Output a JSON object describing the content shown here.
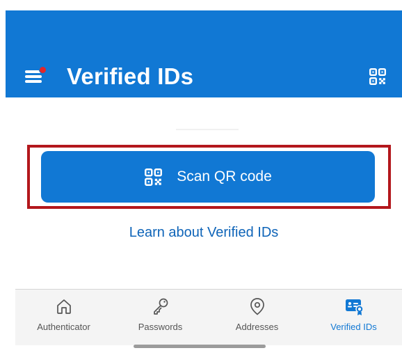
{
  "header": {
    "title": "Verified IDs",
    "menu_icon": "hamburger-menu-icon",
    "notification_dot_color": "#e3262a",
    "action_icon": "qr-code-icon"
  },
  "main": {
    "scan_button_label": "Scan QR code",
    "scan_button_icon": "qr-code-icon",
    "learn_link": "Learn about Verified IDs",
    "highlight_color": "#b3171c"
  },
  "bottom_nav": {
    "items": [
      {
        "label": "Authenticator",
        "icon": "home-icon",
        "active": false
      },
      {
        "label": "Passwords",
        "icon": "key-icon",
        "active": false
      },
      {
        "label": "Addresses",
        "icon": "location-pin-icon",
        "active": false
      },
      {
        "label": "Verified IDs",
        "icon": "verified-id-card-icon",
        "active": true
      }
    ]
  },
  "colors": {
    "accent": "#1178d4",
    "link": "#0e64b8",
    "nav_background": "#f4f4f4",
    "inactive_label": "#555555"
  }
}
